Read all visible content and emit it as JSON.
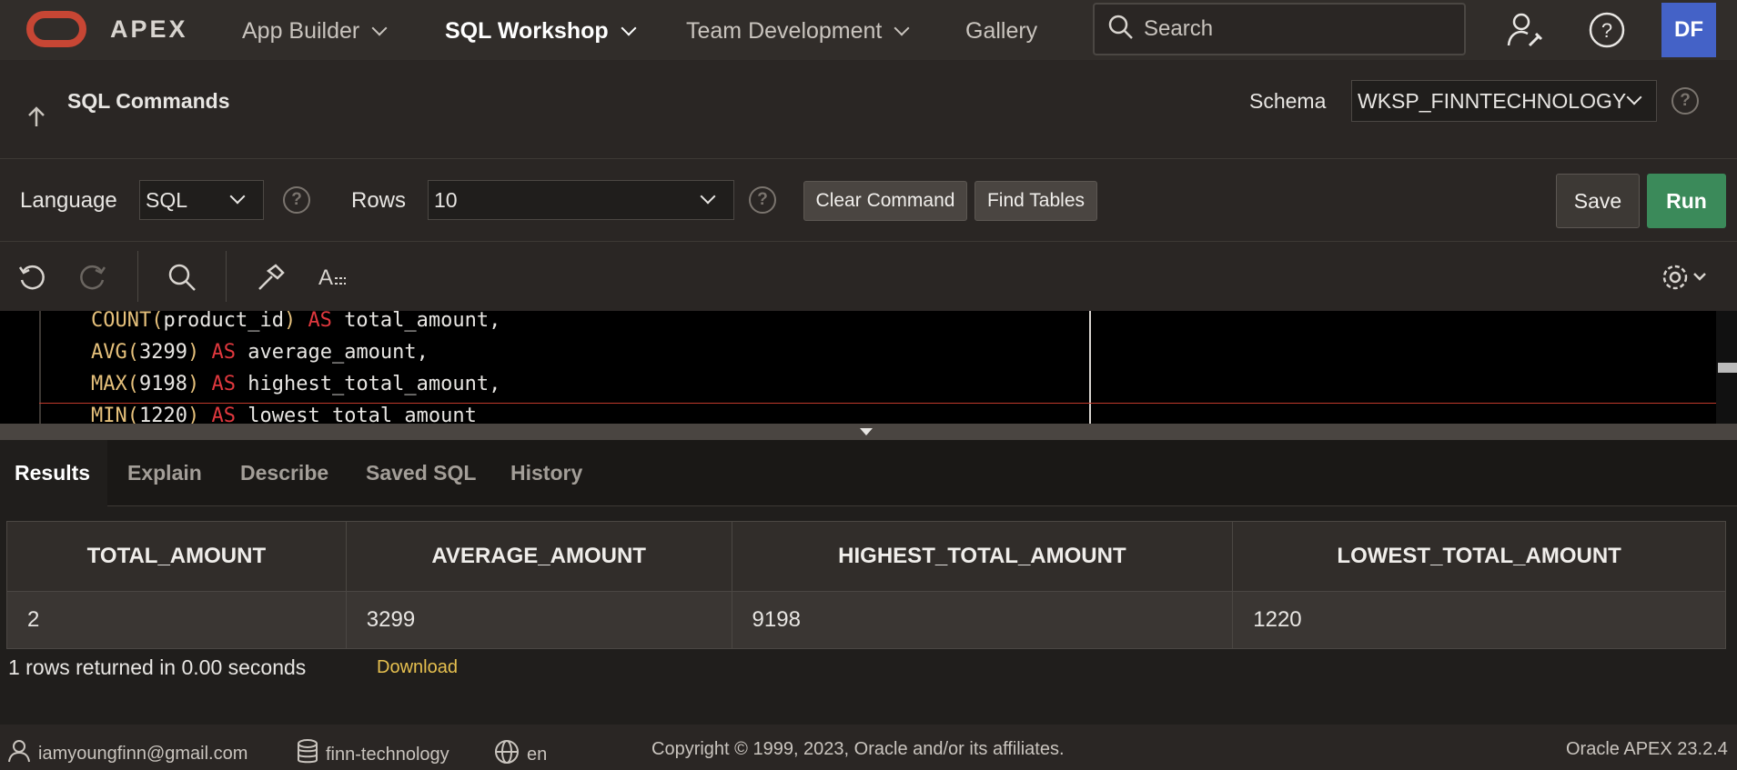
{
  "nav": {
    "brand": "APEX",
    "items": [
      {
        "label": "App Builder"
      },
      {
        "label": "SQL Workshop"
      },
      {
        "label": "Team Development"
      },
      {
        "label": "Gallery"
      }
    ],
    "search_placeholder": "Search",
    "avatar_initials": "DF"
  },
  "page": {
    "title": "SQL Commands",
    "schema_label": "Schema",
    "schema_value": "WKSP_FINNTECHNOLOGY"
  },
  "toolbar": {
    "language_label": "Language",
    "language_value": "SQL",
    "rows_label": "Rows",
    "rows_value": "10",
    "clear_command": "Clear Command",
    "find_tables": "Find Tables",
    "save": "Save",
    "run": "Run"
  },
  "editor": {
    "lines": [
      {
        "fn": "COUNT",
        "arg": "product_id",
        "alias": "total_amount",
        "end": ","
      },
      {
        "fn": "AVG",
        "arg": "3299",
        "alias": "average_amount",
        "end": ","
      },
      {
        "fn": "MAX",
        "arg": "9198",
        "alias": "highest_total_amount",
        "end": ","
      },
      {
        "fn": "MIN",
        "arg": "1220",
        "alias": "lowest_total_amount",
        "end": ""
      }
    ],
    "keyword": "AS"
  },
  "tabs": [
    "Results",
    "Explain",
    "Describe",
    "Saved SQL",
    "History"
  ],
  "results": {
    "columns": [
      "TOTAL_AMOUNT",
      "AVERAGE_AMOUNT",
      "HIGHEST_TOTAL_AMOUNT",
      "LOWEST_TOTAL_AMOUNT"
    ],
    "rows": [
      [
        "2",
        "3299",
        "9198",
        "1220"
      ]
    ],
    "status": "1 rows returned in 0.00 seconds",
    "download": "Download"
  },
  "footer": {
    "user": "iamyoungfinn@gmail.com",
    "workspace": "finn-technology",
    "language": "en",
    "copyright": "Copyright © 1999, 2023, Oracle and/or its affiliates.",
    "version": "Oracle APEX 23.2.4"
  }
}
